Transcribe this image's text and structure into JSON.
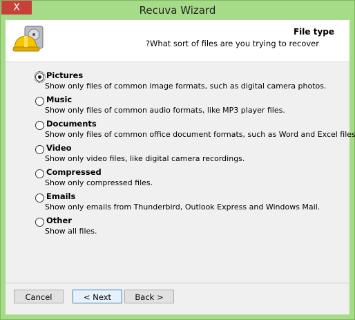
{
  "window": {
    "title": "Recuva Wizard",
    "close_glyph": "X"
  },
  "header": {
    "title": "File type",
    "subtitle": "?What sort of files are you trying to recover",
    "logo_icon": "recuva-hardhat-drive-icon"
  },
  "options": [
    {
      "label": "Pictures",
      "description": "Show only files of common image formats, such as digital camera photos.",
      "selected": true
    },
    {
      "label": "Music",
      "description": "Show only files of common audio formats, like MP3 player files.",
      "selected": false
    },
    {
      "label": "Documents",
      "description": "Show only files of common office document formats, such as Word and Excel files.",
      "selected": false
    },
    {
      "label": "Video",
      "description": "Show only video files, like digital camera recordings.",
      "selected": false
    },
    {
      "label": "Compressed",
      "description": "Show only compressed files.",
      "selected": false
    },
    {
      "label": "Emails",
      "description": "Show only emails from Thunderbird, Outlook Express and Windows Mail.",
      "selected": false
    },
    {
      "label": "Other",
      "description": "Show all files.",
      "selected": false
    }
  ],
  "buttons": {
    "cancel": "Cancel",
    "next": "< Next",
    "back": "Back >"
  },
  "colors": {
    "frame": "#a6dc89",
    "close": "#c7403a",
    "panel": "#f0f0f0",
    "primary_border": "#3c7fb1"
  }
}
